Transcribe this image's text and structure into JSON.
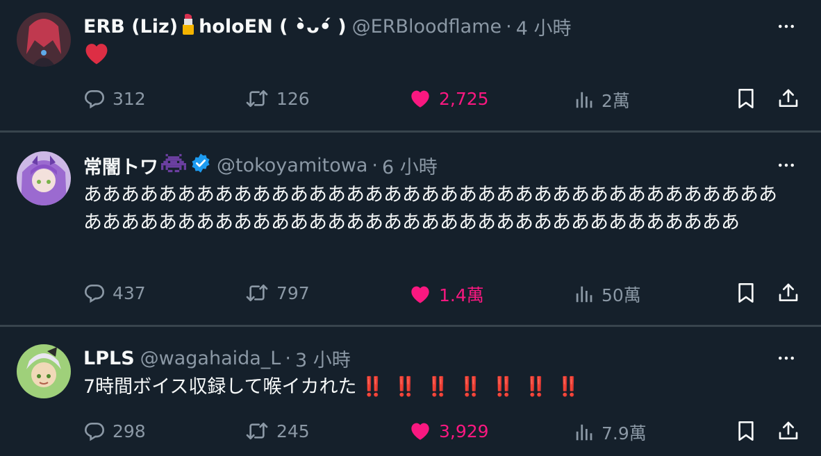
{
  "tweets": [
    {
      "name": "ERB (Liz)",
      "name_suffix": "holoEN ( •̀ᴗ•́ )",
      "handle": "@ERBloodflame",
      "dot": "·",
      "time": "4 小時",
      "text": "❤️",
      "replies": "312",
      "retweets": "126",
      "likes": "2,725",
      "views": "2萬"
    },
    {
      "name": "常闇トワ",
      "handle": "@tokoyamitowa",
      "dot": "·",
      "time": "6 小時",
      "text": "ああああああああああああああああああああああああああああああああああああああああああああああああああああああああああああああああああああああああ",
      "replies": "437",
      "retweets": "797",
      "likes": "1.4萬",
      "views": "50萬"
    },
    {
      "name": "LPLS",
      "handle": "@wagahaida_L",
      "dot": "·",
      "time": "3 小時",
      "text": "7時間ボイス収録して喉イカれた",
      "text_suffix": "‼️ ‼️ ‼️ ‼️ ‼️ ‼️ ‼️",
      "replies": "298",
      "retweets": "245",
      "likes": "3,929",
      "views": "7.9萬"
    }
  ],
  "colors": {
    "background": "#15202b",
    "text": "#f7f9f9",
    "muted": "#8b98a5",
    "like": "#f91880",
    "verified": "#1d9bf0",
    "separator": "#38444d"
  },
  "icons": [
    "reply-icon",
    "retweet-icon",
    "like-icon",
    "views-icon",
    "bookmark-icon",
    "share-icon",
    "more-icon",
    "verified-badge-icon",
    "lipstick-icon",
    "space-invader-icon"
  ]
}
